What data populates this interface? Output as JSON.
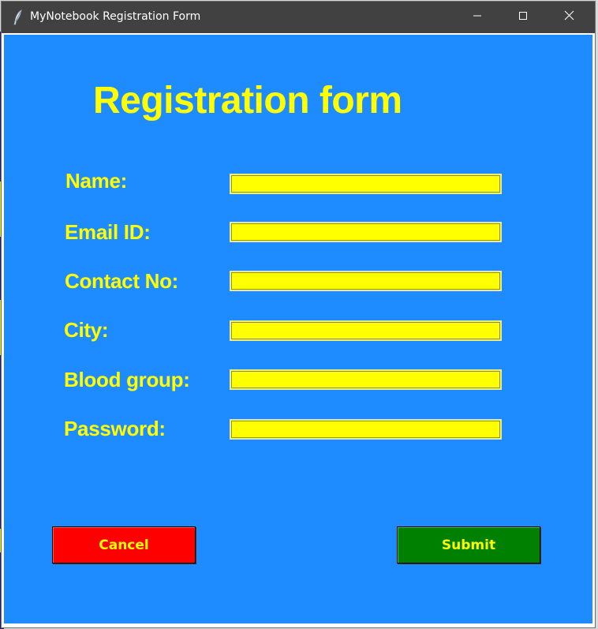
{
  "window": {
    "title": "MyNotebook Registration Form",
    "controls": {
      "minimize": "minimize-icon",
      "maximize": "maximize-icon",
      "close": "close-icon"
    }
  },
  "form": {
    "heading": "Registration form",
    "fields": [
      {
        "label": "Name:",
        "value": ""
      },
      {
        "label": "Email ID:",
        "value": ""
      },
      {
        "label": "Contact No:",
        "value": ""
      },
      {
        "label": "City:",
        "value": ""
      },
      {
        "label": "Blood group:",
        "value": ""
      },
      {
        "label": "Password:",
        "value": ""
      }
    ],
    "cancel_label": "Cancel",
    "submit_label": "Submit"
  },
  "colors": {
    "background": "#1e8cff",
    "text_accent": "#ffff00",
    "field_bg": "#ffff00",
    "cancel_bg": "#ff0000",
    "submit_bg": "#008000",
    "titlebar": "#414141"
  }
}
